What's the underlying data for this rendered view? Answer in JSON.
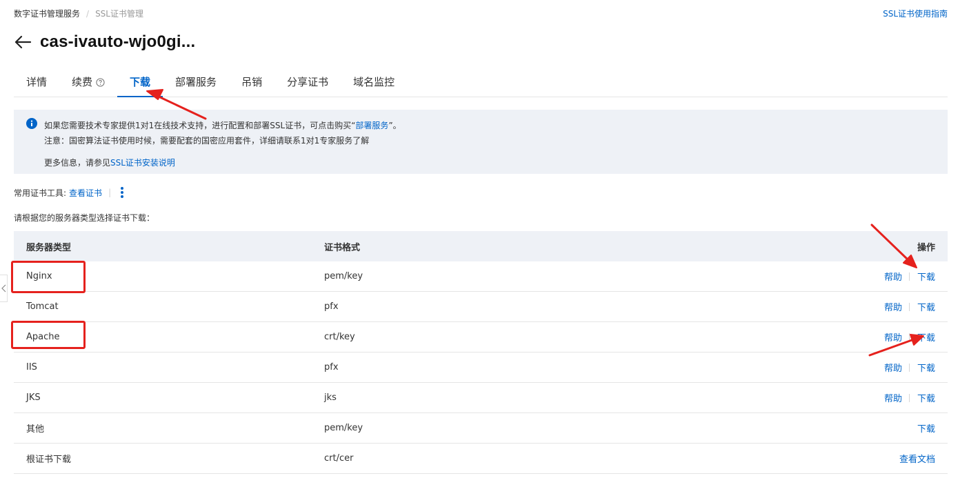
{
  "breadcrumb": {
    "root": "数字证书管理服务",
    "separator": "/",
    "current": "SSL证书管理"
  },
  "header": {
    "guide_link": "SSL证书使用指南",
    "title": "cas-ivauto-wjo0gi..."
  },
  "tabs": [
    {
      "label": "详情",
      "active": false
    },
    {
      "label": "续费",
      "active": false,
      "icon": "help-circle-icon"
    },
    {
      "label": "下载",
      "active": true
    },
    {
      "label": "部署服务",
      "active": false
    },
    {
      "label": "吊销",
      "active": false
    },
    {
      "label": "分享证书",
      "active": false
    },
    {
      "label": "域名监控",
      "active": false
    }
  ],
  "notice": {
    "icon": "info-icon",
    "line1_prefix": "如果您需要技术专家提供1对1在线技术支持，进行配置和部署SSL证书，可点击购买“",
    "line1_link": "部署服务",
    "line1_suffix": "”。",
    "line2": "注意：国密算法证书使用时候，需要配套的国密应用套件，详细请联系1对1专家服务了解",
    "line3_prefix": "更多信息，请参见",
    "line3_link": "SSL证书安装说明"
  },
  "tools": {
    "label": "常用证书工具:",
    "link": "查看证书",
    "separator": "|"
  },
  "instruction": "请根据您的服务器类型选择证书下载：",
  "table": {
    "headers": {
      "type": "服务器类型",
      "format": "证书格式",
      "ops": "操作"
    },
    "rows": [
      {
        "type": "Nginx",
        "format": "pem/key",
        "help": "帮助",
        "download": "下载"
      },
      {
        "type": "Tomcat",
        "format": "pfx",
        "help": "帮助",
        "download": "下载"
      },
      {
        "type": "Apache",
        "format": "crt/key",
        "help": "帮助",
        "download": "下载"
      },
      {
        "type": "IIS",
        "format": "pfx",
        "help": "帮助",
        "download": "下载"
      },
      {
        "type": "JKS",
        "format": "jks",
        "help": "帮助",
        "download": "下载"
      },
      {
        "type": "其他",
        "format": "pem/key",
        "download": "下载"
      },
      {
        "type": "根证书下载",
        "format": "crt/cer",
        "doc": "查看文档"
      }
    ]
  },
  "colors": {
    "accent": "#0064c8",
    "annotation": "#e5211d",
    "header_bg": "#eef1f6"
  }
}
